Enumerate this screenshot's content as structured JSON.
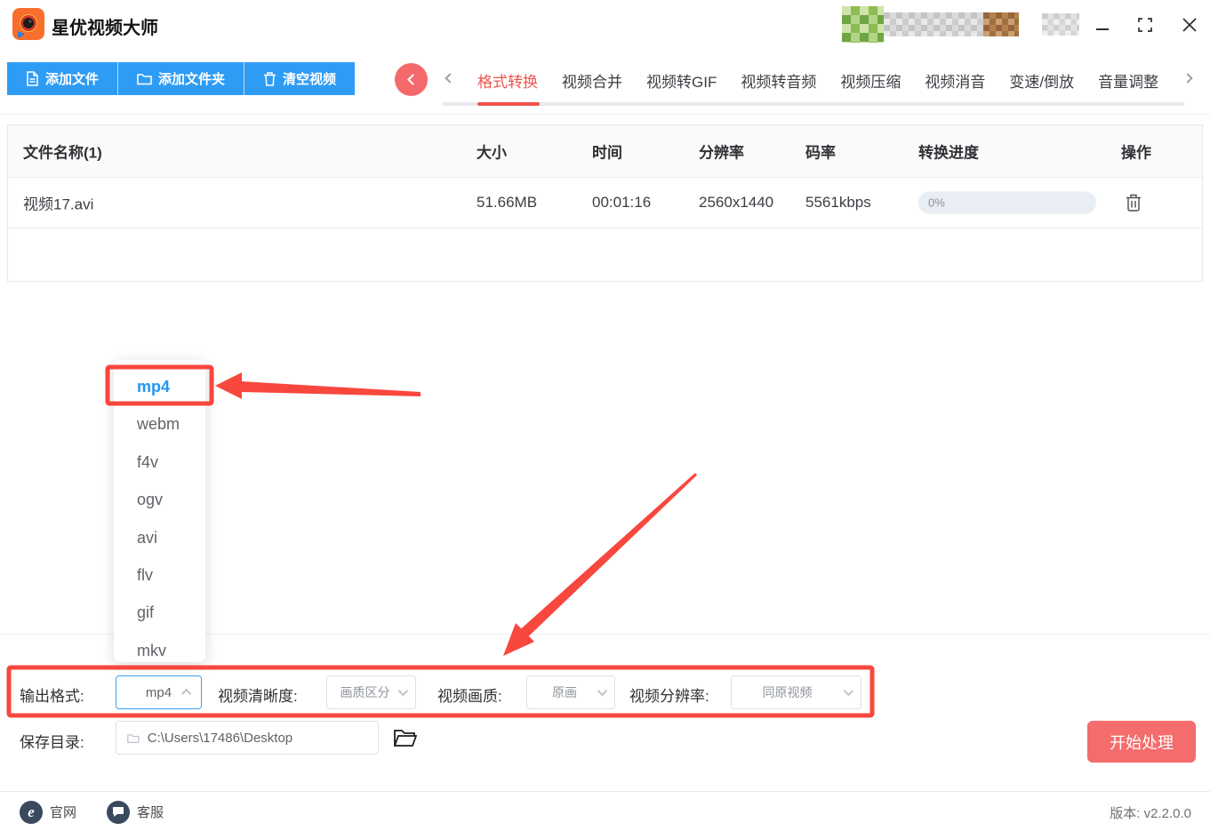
{
  "titlebar": {
    "app_name": "星优视频大师"
  },
  "toolbar": {
    "add_file": "添加文件",
    "add_folder": "添加文件夹",
    "clear_videos": "清空视频"
  },
  "tabs": {
    "items": [
      "格式转换",
      "视频合并",
      "视频转GIF",
      "视频转音频",
      "视频压缩",
      "视频消音",
      "变速/倒放",
      "音量调整"
    ],
    "active": "格式转换"
  },
  "table": {
    "headers": [
      "文件名称(1)",
      "大小",
      "时间",
      "分辨率",
      "码率",
      "转换进度",
      "操作"
    ],
    "rows": [
      {
        "name": "视频17.avi",
        "size": "51.66MB",
        "time": "00:01:16",
        "resolution": "2560x1440",
        "bitrate": "5561kbps",
        "progress": "0%"
      }
    ]
  },
  "format_dropdown": {
    "items": [
      "mp4",
      "webm",
      "f4v",
      "ogv",
      "avi",
      "flv",
      "gif",
      "mkv"
    ],
    "selected": "mp4"
  },
  "settings": {
    "output_format": {
      "label": "输出格式:",
      "value": "mp4"
    },
    "clarity": {
      "label": "视频清晰度:",
      "value": "画质区分"
    },
    "quality": {
      "label": "视频画质:",
      "value": "原画"
    },
    "resolution": {
      "label": "视频分辨率:",
      "value": "同原视频"
    }
  },
  "save": {
    "label": "保存目录:",
    "path": "C:\\Users\\17486\\Desktop"
  },
  "actions": {
    "start": "开始处理"
  },
  "footer": {
    "official_site": "官网",
    "support": "客服",
    "version": "版本: v2.2.0.0"
  },
  "colors": {
    "primary_blue": "#2e9cf5",
    "coral_red": "#f56c6c",
    "active_tab_red": "#f0544c",
    "annotation_red": "#f8473d",
    "selected_item_blue": "#2196f3",
    "progress_track": "#e9edf4"
  }
}
